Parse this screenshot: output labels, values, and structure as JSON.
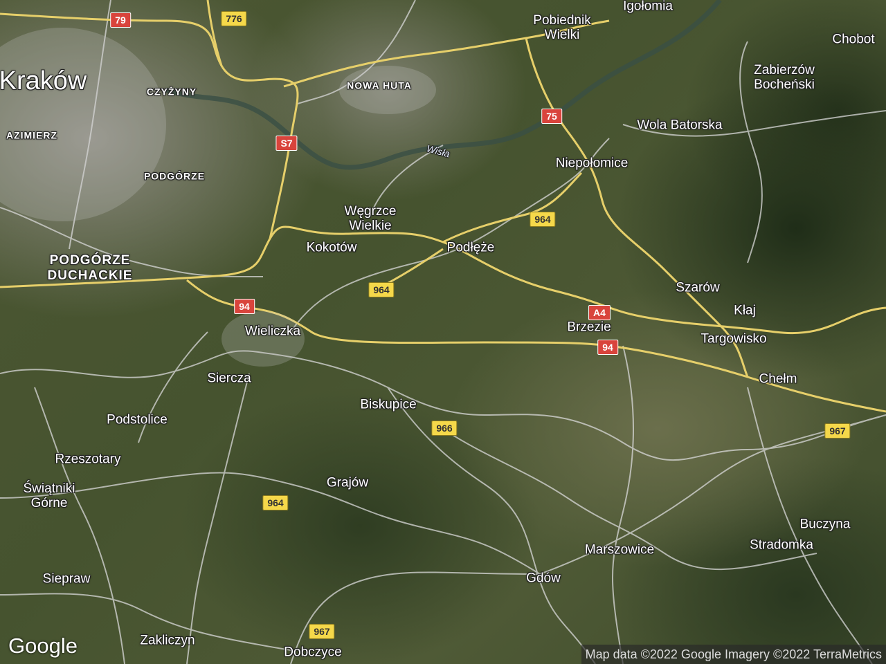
{
  "map": {
    "places": [
      {
        "id": "krakow",
        "label": "Kraków",
        "cls": "big"
      },
      {
        "id": "czyzyny",
        "label": "CZYŻYNY",
        "cls": "district"
      },
      {
        "id": "nowa-huta",
        "label": "NOWA HUTA",
        "cls": "district"
      },
      {
        "id": "kazimierz",
        "label": "AZIMIERZ",
        "cls": "district"
      },
      {
        "id": "podgorze",
        "label": "PODGÓRZE",
        "cls": "district"
      },
      {
        "id": "podgorze-duchackie",
        "label": "PODGÓRZE\nDUCHACKIE",
        "cls": "district2"
      },
      {
        "id": "igolomia",
        "label": "Igołomia",
        "cls": "town"
      },
      {
        "id": "pobiednik-wielki",
        "label": "Pobiednik\nWielki",
        "cls": "town"
      },
      {
        "id": "chobot",
        "label": "Chobot",
        "cls": "town"
      },
      {
        "id": "zabierzow-bochenski",
        "label": "Zabierzów\nBocheński",
        "cls": "town"
      },
      {
        "id": "wola-batorska",
        "label": "Wola Batorska",
        "cls": "town"
      },
      {
        "id": "niepolomice",
        "label": "Niepołomice",
        "cls": "town"
      },
      {
        "id": "wegrzce-wielkie",
        "label": "Węgrzce\nWielkie",
        "cls": "town"
      },
      {
        "id": "kokotow",
        "label": "Kokotów",
        "cls": "town"
      },
      {
        "id": "podleze",
        "label": "Podłęże",
        "cls": "town"
      },
      {
        "id": "szarow",
        "label": "Szarów",
        "cls": "town"
      },
      {
        "id": "klaj",
        "label": "Kłaj",
        "cls": "town"
      },
      {
        "id": "brzezie",
        "label": "Brzezie",
        "cls": "town"
      },
      {
        "id": "targowisko",
        "label": "Targowisko",
        "cls": "town"
      },
      {
        "id": "wieliczka",
        "label": "Wieliczka",
        "cls": "town"
      },
      {
        "id": "siercza",
        "label": "Siercza",
        "cls": "town"
      },
      {
        "id": "biskupice",
        "label": "Biskupice",
        "cls": "town"
      },
      {
        "id": "chelm",
        "label": "Chełm",
        "cls": "town"
      },
      {
        "id": "podstolice",
        "label": "Podstolice",
        "cls": "town"
      },
      {
        "id": "rzeszotary",
        "label": "Rzeszotary",
        "cls": "town"
      },
      {
        "id": "swiatniki-gorne",
        "label": "Świątniki\nGórne",
        "cls": "town"
      },
      {
        "id": "grajow",
        "label": "Grajów",
        "cls": "town"
      },
      {
        "id": "buczyna",
        "label": "Buczyna",
        "cls": "town"
      },
      {
        "id": "stradomka",
        "label": "Stradomka",
        "cls": "town"
      },
      {
        "id": "marszowice",
        "label": "Marszowice",
        "cls": "town"
      },
      {
        "id": "siepraw",
        "label": "Siepraw",
        "cls": "town"
      },
      {
        "id": "gdow",
        "label": "Gdów",
        "cls": "town"
      },
      {
        "id": "zakliczyn",
        "label": "Zakliczyn",
        "cls": "town"
      },
      {
        "id": "dobczyce",
        "label": "Dobczyce",
        "cls": "town"
      },
      {
        "id": "wisla",
        "label": "Wisła",
        "cls": "river"
      }
    ],
    "shields": [
      {
        "id": "79",
        "label": "79",
        "color": "red"
      },
      {
        "id": "776",
        "label": "776",
        "color": "yellow"
      },
      {
        "id": "75",
        "label": "75",
        "color": "red"
      },
      {
        "id": "s7",
        "label": "S7",
        "color": "red"
      },
      {
        "id": "964-a",
        "label": "964",
        "color": "yellow"
      },
      {
        "id": "964-b",
        "label": "964",
        "color": "yellow"
      },
      {
        "id": "94-a",
        "label": "94",
        "color": "red"
      },
      {
        "id": "a4",
        "label": "A4",
        "color": "red"
      },
      {
        "id": "94-b",
        "label": "94",
        "color": "red"
      },
      {
        "id": "966",
        "label": "966",
        "color": "yellow"
      },
      {
        "id": "967-a",
        "label": "967",
        "color": "yellow"
      },
      {
        "id": "964-c",
        "label": "964",
        "color": "yellow"
      },
      {
        "id": "967-b",
        "label": "967",
        "color": "yellow"
      }
    ]
  },
  "google_logo": "Google",
  "attribution": "Map data ©2022 Google Imagery ©2022 TerraMetrics",
  "colors": {
    "highway": "#e6cf6a",
    "local_road": "#d8d8d8",
    "shield_yellow": "#f5d84a",
    "shield_red": "#d9443c"
  }
}
